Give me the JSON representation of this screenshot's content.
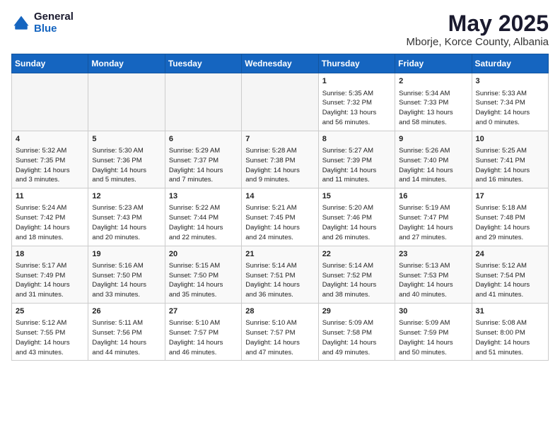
{
  "logo": {
    "general": "General",
    "blue": "Blue"
  },
  "title": "May 2025",
  "location": "Mborje, Korce County, Albania",
  "weekdays": [
    "Sunday",
    "Monday",
    "Tuesday",
    "Wednesday",
    "Thursday",
    "Friday",
    "Saturday"
  ],
  "weeks": [
    [
      {
        "day": "",
        "info": ""
      },
      {
        "day": "",
        "info": ""
      },
      {
        "day": "",
        "info": ""
      },
      {
        "day": "",
        "info": ""
      },
      {
        "day": "1",
        "info": "Sunrise: 5:35 AM\nSunset: 7:32 PM\nDaylight: 13 hours\nand 56 minutes."
      },
      {
        "day": "2",
        "info": "Sunrise: 5:34 AM\nSunset: 7:33 PM\nDaylight: 13 hours\nand 58 minutes."
      },
      {
        "day": "3",
        "info": "Sunrise: 5:33 AM\nSunset: 7:34 PM\nDaylight: 14 hours\nand 0 minutes."
      }
    ],
    [
      {
        "day": "4",
        "info": "Sunrise: 5:32 AM\nSunset: 7:35 PM\nDaylight: 14 hours\nand 3 minutes."
      },
      {
        "day": "5",
        "info": "Sunrise: 5:30 AM\nSunset: 7:36 PM\nDaylight: 14 hours\nand 5 minutes."
      },
      {
        "day": "6",
        "info": "Sunrise: 5:29 AM\nSunset: 7:37 PM\nDaylight: 14 hours\nand 7 minutes."
      },
      {
        "day": "7",
        "info": "Sunrise: 5:28 AM\nSunset: 7:38 PM\nDaylight: 14 hours\nand 9 minutes."
      },
      {
        "day": "8",
        "info": "Sunrise: 5:27 AM\nSunset: 7:39 PM\nDaylight: 14 hours\nand 11 minutes."
      },
      {
        "day": "9",
        "info": "Sunrise: 5:26 AM\nSunset: 7:40 PM\nDaylight: 14 hours\nand 14 minutes."
      },
      {
        "day": "10",
        "info": "Sunrise: 5:25 AM\nSunset: 7:41 PM\nDaylight: 14 hours\nand 16 minutes."
      }
    ],
    [
      {
        "day": "11",
        "info": "Sunrise: 5:24 AM\nSunset: 7:42 PM\nDaylight: 14 hours\nand 18 minutes."
      },
      {
        "day": "12",
        "info": "Sunrise: 5:23 AM\nSunset: 7:43 PM\nDaylight: 14 hours\nand 20 minutes."
      },
      {
        "day": "13",
        "info": "Sunrise: 5:22 AM\nSunset: 7:44 PM\nDaylight: 14 hours\nand 22 minutes."
      },
      {
        "day": "14",
        "info": "Sunrise: 5:21 AM\nSunset: 7:45 PM\nDaylight: 14 hours\nand 24 minutes."
      },
      {
        "day": "15",
        "info": "Sunrise: 5:20 AM\nSunset: 7:46 PM\nDaylight: 14 hours\nand 26 minutes."
      },
      {
        "day": "16",
        "info": "Sunrise: 5:19 AM\nSunset: 7:47 PM\nDaylight: 14 hours\nand 27 minutes."
      },
      {
        "day": "17",
        "info": "Sunrise: 5:18 AM\nSunset: 7:48 PM\nDaylight: 14 hours\nand 29 minutes."
      }
    ],
    [
      {
        "day": "18",
        "info": "Sunrise: 5:17 AM\nSunset: 7:49 PM\nDaylight: 14 hours\nand 31 minutes."
      },
      {
        "day": "19",
        "info": "Sunrise: 5:16 AM\nSunset: 7:50 PM\nDaylight: 14 hours\nand 33 minutes."
      },
      {
        "day": "20",
        "info": "Sunrise: 5:15 AM\nSunset: 7:50 PM\nDaylight: 14 hours\nand 35 minutes."
      },
      {
        "day": "21",
        "info": "Sunrise: 5:14 AM\nSunset: 7:51 PM\nDaylight: 14 hours\nand 36 minutes."
      },
      {
        "day": "22",
        "info": "Sunrise: 5:14 AM\nSunset: 7:52 PM\nDaylight: 14 hours\nand 38 minutes."
      },
      {
        "day": "23",
        "info": "Sunrise: 5:13 AM\nSunset: 7:53 PM\nDaylight: 14 hours\nand 40 minutes."
      },
      {
        "day": "24",
        "info": "Sunrise: 5:12 AM\nSunset: 7:54 PM\nDaylight: 14 hours\nand 41 minutes."
      }
    ],
    [
      {
        "day": "25",
        "info": "Sunrise: 5:12 AM\nSunset: 7:55 PM\nDaylight: 14 hours\nand 43 minutes."
      },
      {
        "day": "26",
        "info": "Sunrise: 5:11 AM\nSunset: 7:56 PM\nDaylight: 14 hours\nand 44 minutes."
      },
      {
        "day": "27",
        "info": "Sunrise: 5:10 AM\nSunset: 7:57 PM\nDaylight: 14 hours\nand 46 minutes."
      },
      {
        "day": "28",
        "info": "Sunrise: 5:10 AM\nSunset: 7:57 PM\nDaylight: 14 hours\nand 47 minutes."
      },
      {
        "day": "29",
        "info": "Sunrise: 5:09 AM\nSunset: 7:58 PM\nDaylight: 14 hours\nand 49 minutes."
      },
      {
        "day": "30",
        "info": "Sunrise: 5:09 AM\nSunset: 7:59 PM\nDaylight: 14 hours\nand 50 minutes."
      },
      {
        "day": "31",
        "info": "Sunrise: 5:08 AM\nSunset: 8:00 PM\nDaylight: 14 hours\nand 51 minutes."
      }
    ]
  ]
}
